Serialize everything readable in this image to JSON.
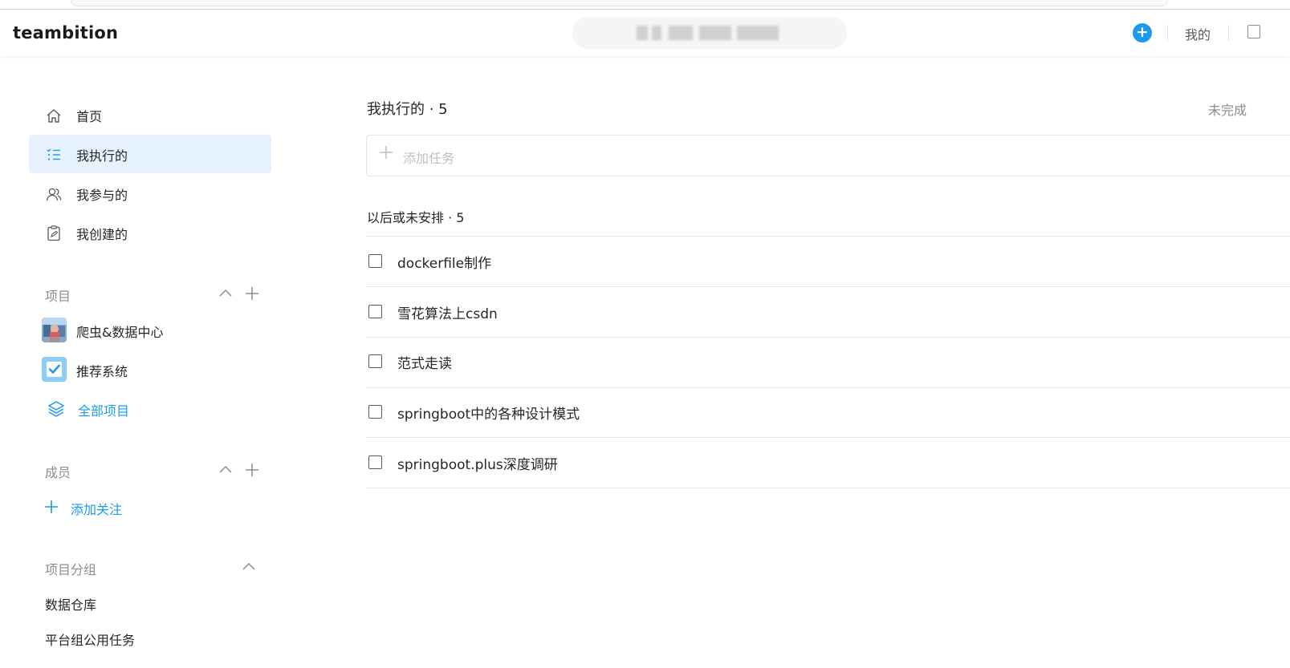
{
  "header": {
    "logo": "teambition",
    "mine_label": "我的",
    "add_symbol": "+",
    "accent": "#1b9aee"
  },
  "sidebar": {
    "nav": [
      {
        "label": "首页",
        "icon": "home-icon"
      },
      {
        "label": "我执行的",
        "icon": "task-list-icon",
        "active": true
      },
      {
        "label": "我参与的",
        "icon": "users-icon"
      },
      {
        "label": "我创建的",
        "icon": "clipboard-icon"
      }
    ],
    "projects": {
      "title": "项目",
      "items": [
        {
          "label": "爬虫&数据中心",
          "icon": "project-avatar-photo"
        },
        {
          "label": "推荐系统",
          "icon": "project-avatar-check"
        }
      ],
      "all_label": "全部项目"
    },
    "members": {
      "title": "成员",
      "add_label": "添加关注"
    },
    "groups": {
      "title": "项目分组",
      "items": [
        "数据仓库",
        "平台组公用任务"
      ]
    }
  },
  "main": {
    "title": "我执行的 · 5",
    "filter_label": "未完成",
    "add_task_placeholder": "添加任务",
    "section_title": "以后或未安排 · 5",
    "tasks": [
      {
        "title": "dockerfile制作",
        "done": false
      },
      {
        "title": "雪花算法上csdn",
        "done": false
      },
      {
        "title": "范式走读",
        "done": false
      },
      {
        "title": "springboot中的各种设计模式",
        "done": false
      },
      {
        "title": "springboot.plus深度调研",
        "done": false
      }
    ]
  }
}
